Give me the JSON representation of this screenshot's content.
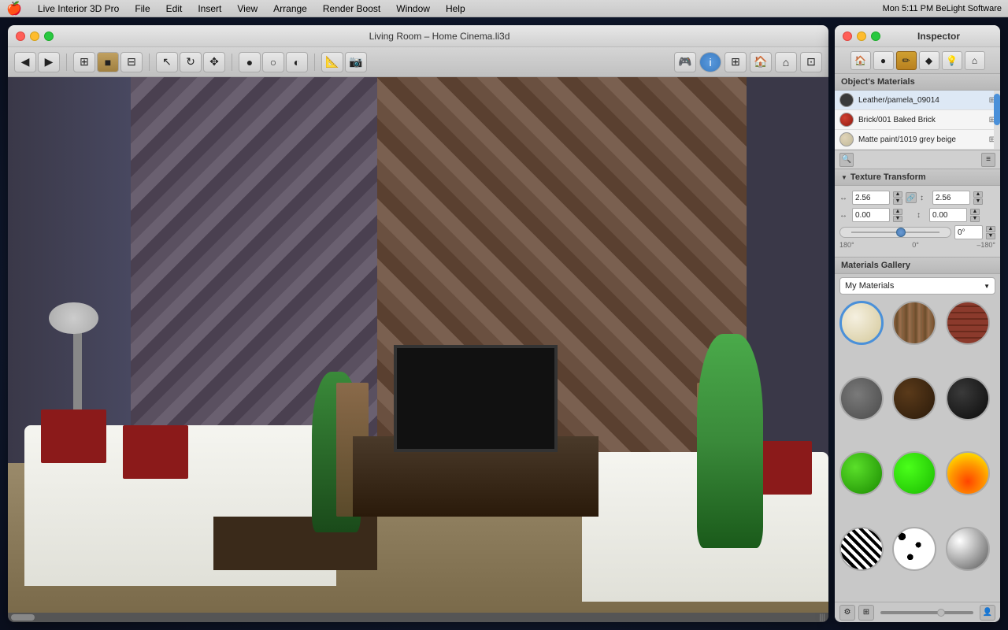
{
  "menubar": {
    "apple": "🍎",
    "items": [
      "Live Interior 3D Pro",
      "File",
      "Edit",
      "Insert",
      "View",
      "Arrange",
      "Render Boost",
      "Window",
      "Help"
    ],
    "right": "Mon 5:11 PM    BeLight Software"
  },
  "main_window": {
    "title": "Living Room – Home Cinema.li3d",
    "traffic_lights": {
      "red": "●",
      "yellow": "●",
      "green": "●"
    }
  },
  "toolbar": {
    "nav_back": "←",
    "nav_fwd": "→",
    "btn_floor": "🏠",
    "btn_camera": "📷",
    "btn_render": "⚡",
    "btn_info": "ℹ",
    "btn_zoom": "⊞"
  },
  "inspector": {
    "title": "Inspector",
    "tabs": [
      "🏠",
      "●",
      "✏",
      "◆",
      "💡",
      "🏠"
    ],
    "materials_section_label": "Object's Materials",
    "materials": [
      {
        "name": "Leather/pamela_09014",
        "color": "#3a3a3a",
        "icon": "⊞"
      },
      {
        "name": "Brick/001 Baked Brick",
        "color": "#c03020",
        "icon": "⊞"
      },
      {
        "name": "Matte paint/1019 grey beige",
        "color": "#d4c8b0",
        "icon": "⊞"
      }
    ],
    "texture_transform_label": "Texture Transform",
    "tt_h1": "2.56",
    "tt_v1": "2.56",
    "tt_h2": "0.00",
    "tt_v2": "0.00",
    "rotation_value": "0°",
    "rotation_min": "180°",
    "rotation_mid": "0°",
    "rotation_max": "–180°",
    "gallery_section_label": "Materials Gallery",
    "gallery_dropdown": "My Materials",
    "gallery_dropdown_arrow": "▼",
    "gallery_materials": [
      {
        "name": "cream-mat",
        "class": "mat-cream",
        "selected": true
      },
      {
        "name": "wood-mat",
        "class": "mat-wood",
        "selected": false
      },
      {
        "name": "brick-mat",
        "class": "mat-brick",
        "selected": false
      },
      {
        "name": "concrete-mat",
        "class": "mat-concrete",
        "selected": false
      },
      {
        "name": "dark-wood-mat",
        "class": "mat-dark-wood",
        "selected": false
      },
      {
        "name": "black-mat",
        "class": "mat-black",
        "selected": false
      },
      {
        "name": "green-mat",
        "class": "mat-green",
        "selected": false
      },
      {
        "name": "bright-green-mat",
        "class": "mat-bright-green",
        "selected": false
      },
      {
        "name": "fire-mat",
        "class": "mat-fire",
        "selected": false
      },
      {
        "name": "zebra-mat",
        "class": "mat-zebra",
        "selected": false
      },
      {
        "name": "spots-mat",
        "class": "mat-spots",
        "selected": false
      },
      {
        "name": "chrome-mat",
        "class": "mat-chrome",
        "selected": false
      }
    ]
  }
}
